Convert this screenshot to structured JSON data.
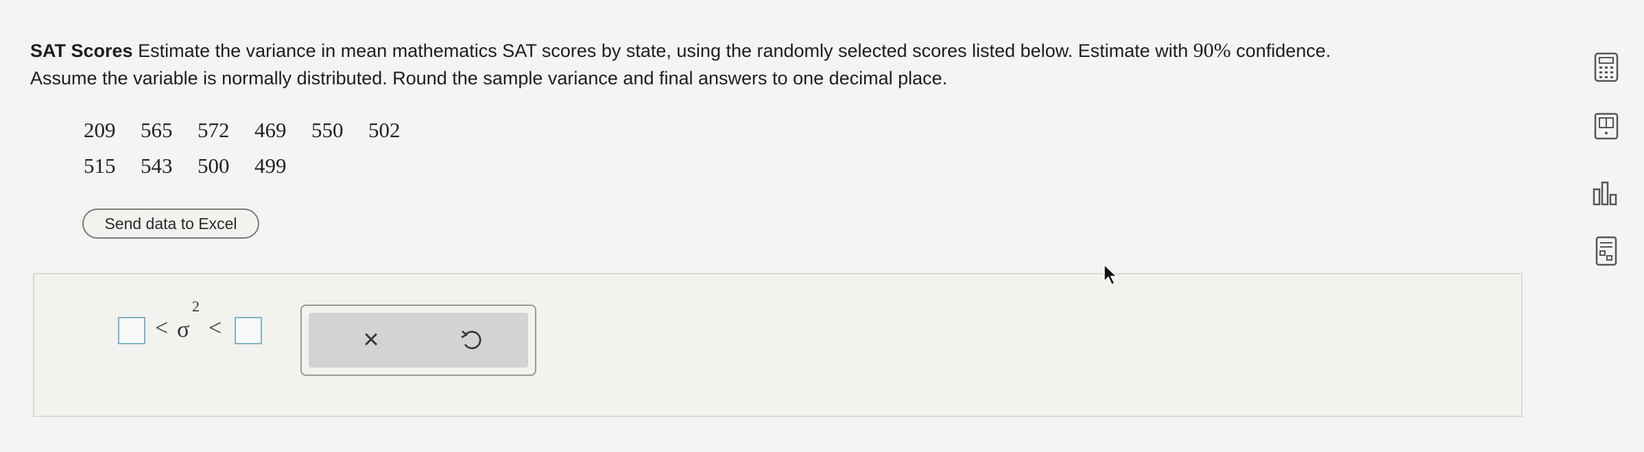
{
  "problem": {
    "title": "SAT Scores",
    "line1": "Estimate the variance in mean mathematics SAT scores by state, using the randomly selected scores listed below. Estimate with ",
    "confidence": "90%",
    "line1_end": " confidence.",
    "line2": "Assume the variable is normally distributed. Round the sample variance and final answers to one decimal place."
  },
  "data": {
    "row1": [
      "209",
      "565",
      "572",
      "469",
      "550",
      "502"
    ],
    "row2": [
      "515",
      "543",
      "500",
      "499"
    ]
  },
  "excel_button": {
    "label": "Send data to Excel"
  },
  "answer": {
    "lower_value": "",
    "upper_value": "",
    "less_than": "<",
    "sigma": "σ",
    "exponent": "2"
  },
  "actions": {
    "clear_label": "×"
  },
  "side_tools": [
    "calculator-icon",
    "textbook-icon",
    "statistics-chart-icon",
    "formula-sheet-icon"
  ],
  "colors": {
    "input_border": "#7fb2c4",
    "panel_border": "#d8d8d3",
    "button_gray": "#d3d3d3"
  }
}
